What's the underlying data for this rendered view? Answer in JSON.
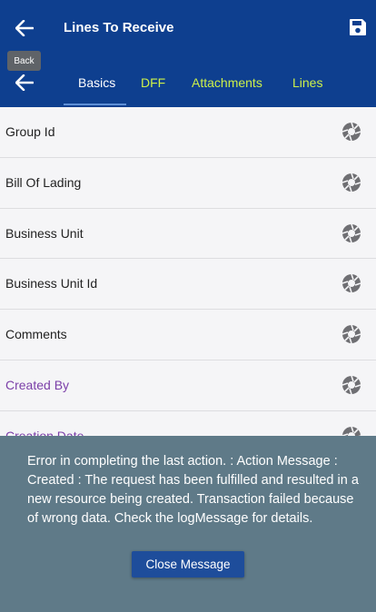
{
  "header": {
    "title": "Lines To Receive",
    "back_tooltip": "Back",
    "icons": {
      "back": "arrow-left-icon",
      "save": "save-icon"
    }
  },
  "tabs": [
    {
      "label": "Basics",
      "active": true
    },
    {
      "label": "DFF",
      "active": false
    },
    {
      "label": "Attachments",
      "active": false
    },
    {
      "label": "Lines",
      "active": false
    }
  ],
  "colors": {
    "primary": "#0e3f8f",
    "tab_inactive": "#ccf04a",
    "link_purple": "#7b3fa8",
    "overlay": "#5f7a88",
    "button": "#1e4d9b"
  },
  "fields": [
    {
      "label": "Group Id",
      "icon": "camera-shutter-icon"
    },
    {
      "label": "Bill Of Lading",
      "icon": "camera-shutter-icon"
    },
    {
      "label": "Business Unit",
      "icon": "camera-shutter-icon"
    },
    {
      "label": "Business Unit Id",
      "icon": "camera-shutter-icon"
    },
    {
      "label": "Comments",
      "icon": "camera-shutter-icon"
    },
    {
      "label": "Created By",
      "icon": "camera-shutter-icon"
    },
    {
      "label": "Creation Date",
      "icon": "camera-shutter-icon"
    }
  ],
  "error": {
    "message": "Error in completing the last action.  : Action Message : Created : The request has been fulfilled and resulted in a new resource being created. Transaction failed because of wrong data. Check the logMessage for details.",
    "close_label": "Close Message"
  }
}
